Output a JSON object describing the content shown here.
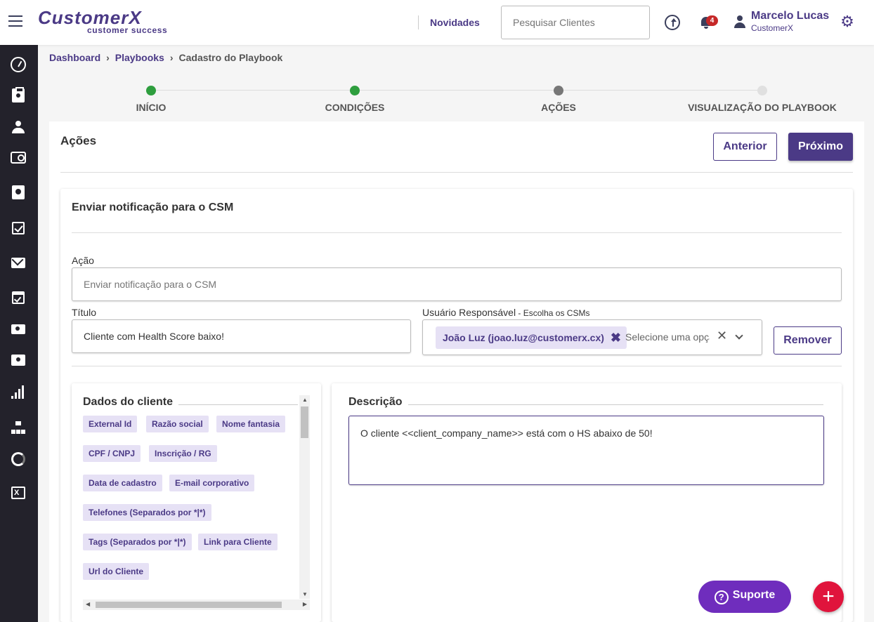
{
  "header": {
    "logo_main": "CustomerX",
    "logo_sub": "customer success",
    "news_link": "Novidades",
    "search_placeholder": "Pesquisar Clientes",
    "notification_count": "4",
    "user_name": "Marcelo Lucas",
    "user_company": "CustomerX"
  },
  "sidebar": {
    "icons": [
      "dashboard-icon",
      "clipboard-icon",
      "group-icon",
      "chat-icon",
      "badge-icon",
      "checkbox-icon",
      "mail-icon",
      "calendar-icon",
      "money-icon",
      "ticket-icon",
      "bar-chart-icon",
      "org-tree-icon",
      "donut-icon",
      "excel-icon"
    ]
  },
  "breadcrumb": {
    "items": [
      "Dashboard",
      "Playbooks",
      "Cadastro do Playbook"
    ],
    "separator": "›"
  },
  "stepper": {
    "steps": [
      {
        "label": "INÍCIO",
        "state": "done",
        "color": "#2e9e3e"
      },
      {
        "label": "CONDIÇÕES",
        "state": "done",
        "color": "#2e9e3e"
      },
      {
        "label": "AÇÕES",
        "state": "current",
        "color": "#777777"
      },
      {
        "label": "VISUALIZAÇÃO DO PLAYBOOK",
        "state": "pending",
        "color": "#e0e0e0"
      }
    ]
  },
  "card": {
    "title": "Ações",
    "prev_label": "Anterior",
    "next_label": "Próximo"
  },
  "action_block": {
    "title": "Enviar notificação para o CSM",
    "action_label": "Ação",
    "action_value": "Enviar notificação para o CSM",
    "title_label": "Título",
    "title_value": "Cliente com Health Score baixo!",
    "responsible_label": "Usuário Responsável",
    "responsible_hint": " - Escolha os CSMs",
    "responsible_chip": "João Luz (joao.luz@customerx.cx)",
    "responsible_placeholder": "Selecione uma opção",
    "remove_label": "Remover"
  },
  "client_data": {
    "title": "Dados do cliente",
    "tags": [
      "External Id",
      "Razão social",
      "Nome fantasia",
      "CPF / CNPJ",
      "Inscrição / RG",
      "Data de cadastro",
      "E-mail corporativo",
      "Telefones (Separados por *|*)",
      "Tags (Separados por *|*)",
      "Link para Cliente",
      "Url do Cliente"
    ]
  },
  "description": {
    "title": "Descrição",
    "value": "O cliente <<client_company_name>> está com o HS abaixo de 50!"
  },
  "support_label": "Suporte",
  "colors": {
    "brand": "#4b3a86",
    "sidebar": "#23222b",
    "fab": "#e0143c",
    "support": "#6f2dbd"
  }
}
